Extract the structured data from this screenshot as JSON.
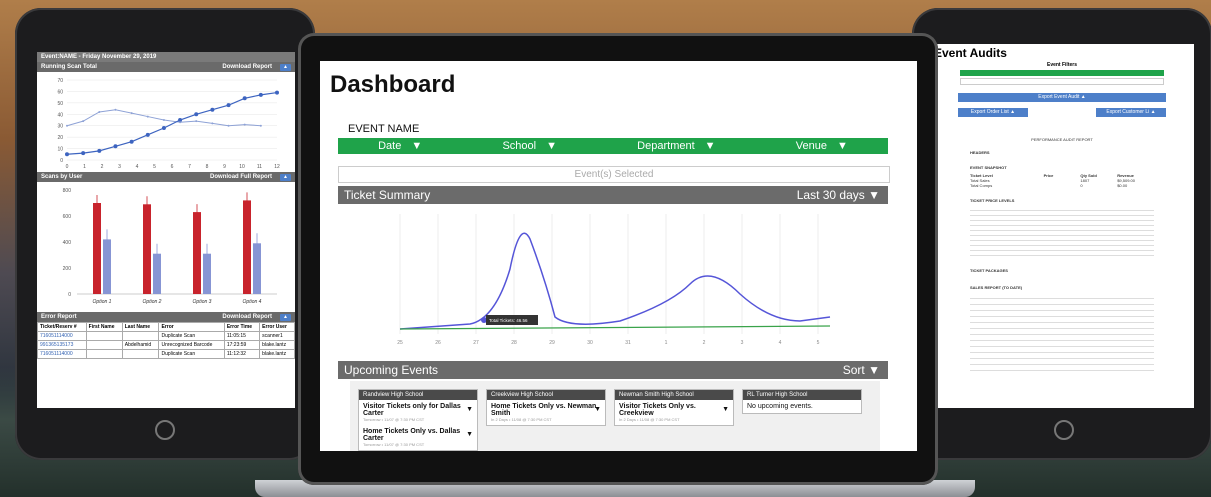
{
  "left_tablet": {
    "header": "Event:NAME - Friday November 29, 2019",
    "section1": {
      "title": "Running Scan Total",
      "action": "Download Report"
    },
    "section2": {
      "title": "Scans by User",
      "action": "Download Full Report"
    },
    "section3": {
      "title": "Error Report",
      "action": "Download Report"
    },
    "line_chart": {
      "y_ticks": [
        "70",
        "60",
        "50",
        "40",
        "30",
        "20",
        "10",
        "0"
      ],
      "x_ticks": [
        "0",
        "1",
        "2",
        "3",
        "4",
        "5",
        "6",
        "7",
        "8",
        "9",
        "10",
        "11",
        "12"
      ],
      "series_a": [
        5,
        6,
        8,
        12,
        16,
        22,
        28,
        35,
        40,
        44,
        48,
        54,
        57,
        59
      ],
      "series_b": [
        30,
        34,
        42,
        44,
        41,
        38,
        35,
        33,
        34,
        32,
        30,
        31,
        30
      ]
    },
    "bar_chart": {
      "y_ticks": [
        "800",
        "600",
        "400",
        "200",
        "0"
      ],
      "categories": [
        "Option 1",
        "Option 2",
        "Option 3",
        "Option 4"
      ],
      "red": [
        700,
        690,
        630,
        720
      ],
      "blue": [
        420,
        310,
        310,
        390
      ]
    },
    "error_table": {
      "headers": [
        "Ticket/Reserv #",
        "First Name",
        "Last Name",
        "Error",
        "Error Time",
        "Error User"
      ],
      "rows": [
        [
          "716051114000",
          "",
          "",
          "Duplicate Scan",
          "11:05:15",
          "scanner1"
        ],
        [
          "991365135173",
          "",
          "Abdelhamid",
          "Unrecognized Barcode",
          "17:23:59",
          "blake.lantz"
        ],
        [
          "716051114000",
          "",
          "",
          "Duplicate Scan",
          "11:12:32",
          "blake.lantz"
        ]
      ]
    }
  },
  "dashboard": {
    "title": "Dashboard",
    "event_name": "EVENT NAME",
    "filters": [
      "Date",
      "School",
      "Department",
      "Venue"
    ],
    "events_selected": "Event(s) Selected",
    "ticket_summary": {
      "title": "Ticket Summary",
      "range": "Last 30 days"
    },
    "chart_tooltip": "Total Tickets: 46.56",
    "chart_x": [
      "25",
      "26",
      "27",
      "28",
      "29",
      "30",
      "31",
      "1",
      "2",
      "3",
      "4",
      "5"
    ],
    "upcoming": {
      "title": "Upcoming Events",
      "sort": "Sort"
    },
    "cards": [
      {
        "school": "Randview High School",
        "items": [
          {
            "name": "Visitor Tickets only for Dallas Carter",
            "sub": "Tomorrow • 11/07 @ 7:30 PM CST"
          },
          {
            "name": "Home Tickets Only vs. Dallas Carter",
            "sub": "Tomorrow • 11/07 @ 7:30 PM CST"
          }
        ]
      },
      {
        "school": "Creekview High School",
        "items": [
          {
            "name": "Home Tickets Only vs. Newman Smith",
            "sub": "In 2 Days • 11/08 @ 7:30 PM CST"
          }
        ]
      },
      {
        "school": "Newman Smith High School",
        "items": [
          {
            "name": "Visitor Tickets Only vs. Creekview",
            "sub": "In 2 Days • 11/08 @ 7:30 PM CST"
          }
        ]
      },
      {
        "school": "RL Turner High School",
        "items": [
          {
            "name": "No upcoming events.",
            "sub": ""
          }
        ]
      }
    ]
  },
  "right_tablet": {
    "title": "Event Audits",
    "filters_label": "Event Filters",
    "export_audit": "Export Event Audit",
    "export_order": "Export Order List",
    "export_customer": "Export Customer Li",
    "report_title": "PERFORMANCE AUDIT REPORT",
    "sections": [
      "HEADERS",
      "EVENT SNAPSHOT",
      "TICKET PRICE LEVELS",
      "TICKET PACKAGES",
      "SALES REPORT (TO DATE)"
    ],
    "snapshot_cols": [
      "Ticket Level",
      "Price",
      "Qty Sold",
      "Revenue"
    ],
    "snapshot_rows": [
      [
        "Total Sales",
        "",
        "1807",
        "$9,509.00"
      ],
      [
        "Total Comps",
        "",
        "0",
        "$0.00"
      ]
    ]
  }
}
